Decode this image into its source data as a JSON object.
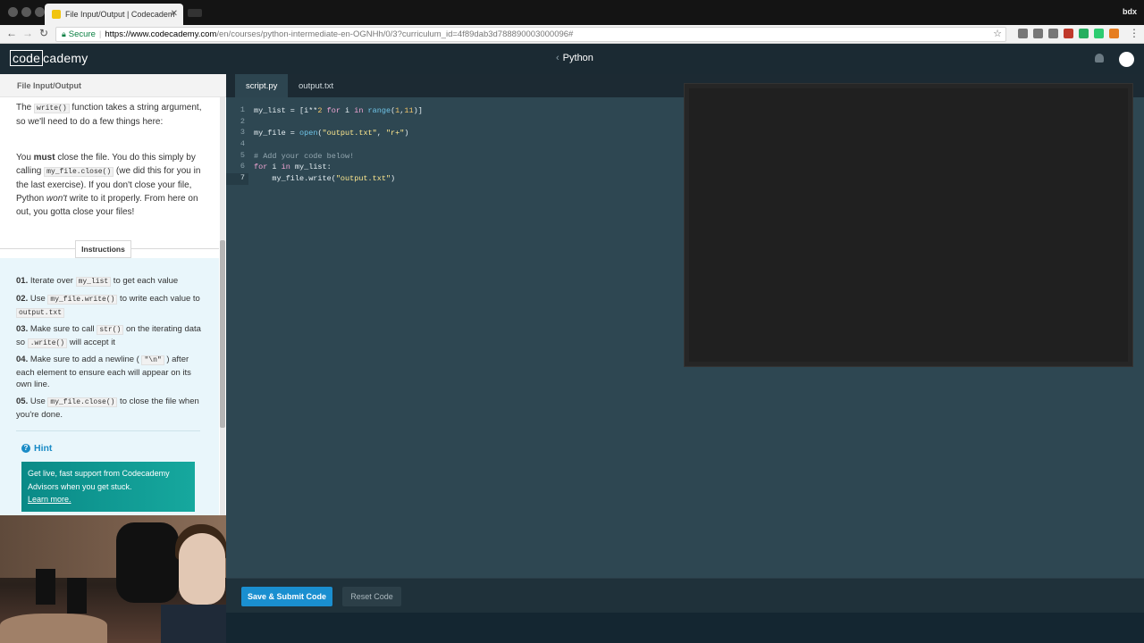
{
  "browser": {
    "tab_title": "File Input/Output | Codecadem",
    "profile_name": "bdx",
    "secure_label": "Secure",
    "url_host": "https://www.codecademy.com",
    "url_path": "/en/courses/python-intermediate-en-OGNHh/0/3?curriculum_id=4f89dab3d788890003000096#"
  },
  "header": {
    "logo_code": "code",
    "logo_rest": "cademy",
    "breadcrumb": "Python"
  },
  "lesson": {
    "title": "File Input/Output",
    "para1_a": "The ",
    "para1_code": "write()",
    "para1_b": " function takes a string argument, so we'll need to do a few things here:",
    "para2_a": "You ",
    "para2_bold": "must",
    "para2_b": " close the file. You do this simply by calling ",
    "para2_code": "my_file.close()",
    "para2_c": " (we did this for you in the last exercise). If you don't close your file, Python ",
    "para2_em": "won't",
    "para2_d": " write to it properly. From here on out, you gotta close your files!",
    "instructions_label": "Instructions",
    "steps": [
      {
        "num": "01.",
        "a": " Iterate over ",
        "code": "my_list",
        "b": " to get each value"
      },
      {
        "num": "02.",
        "a": " Use ",
        "code": "my_file.write()",
        "b": " to write each value to ",
        "code2": "output.txt"
      },
      {
        "num": "03.",
        "a": " Make sure to call ",
        "code": "str()",
        "b": " on the iterating data so ",
        "code2": ".write()",
        "c": " will accept it"
      },
      {
        "num": "04.",
        "a": " Make sure to add a newline ( ",
        "code": "\"\\n\"",
        "b": " ) after each element to ensure each will appear on its own line."
      },
      {
        "num": "05.",
        "a": " Use ",
        "code": "my_file.close()",
        "b": " to close the file when you're done."
      }
    ],
    "hint_label": "Hint",
    "support_text": "Get live, fast support from Codecademy Advisors when you get stuck.",
    "support_link": "Learn more."
  },
  "editor": {
    "tabs": [
      "script.py",
      "output.txt"
    ],
    "line_numbers": [
      "1",
      "2",
      "3",
      "4",
      "5",
      "6",
      "7"
    ],
    "code": {
      "l1_a": "my_list = [i**",
      "l1_num": "2",
      "l1_kw": " for",
      "l1_b": " i ",
      "l1_kw2": "in",
      "l1_fn": " range",
      "l1_c": "(",
      "l1_n1": "1",
      "l1_d": ",",
      "l1_n2": "11",
      "l1_e": ")]",
      "l3_a": "my_file = ",
      "l3_fn": "open",
      "l3_b": "(",
      "l3_s1": "\"output.txt\"",
      "l3_c": ", ",
      "l3_s2": "\"r+\"",
      "l3_d": ")",
      "l5": "# Add your code below!",
      "l6_kw": "for",
      "l6_a": " i ",
      "l6_kw2": "in",
      "l6_b": " my_list:",
      "l7_a": "    my_file.write(",
      "l7_s": "\"output.txt\"",
      "l7_b": ")"
    }
  },
  "footer": {
    "save_label": "Save & Submit Code",
    "reset_label": "Reset Code"
  },
  "colors": {
    "editor_bg": "#2e4752",
    "save_button": "#1a8fd0",
    "support_box": "#0a8a87"
  }
}
